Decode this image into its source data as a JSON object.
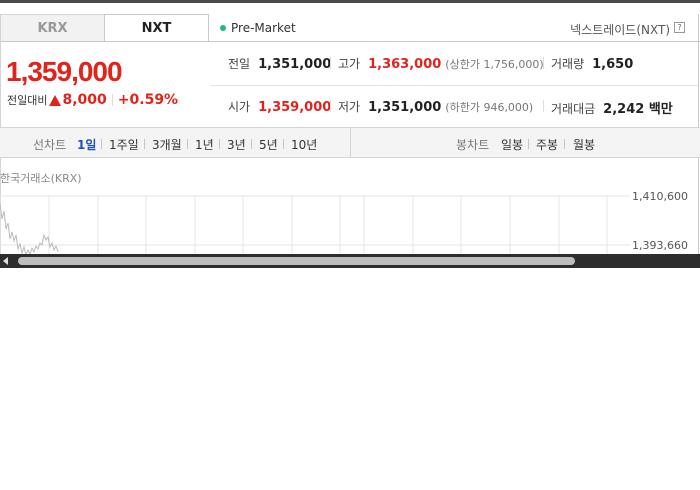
{
  "tabs": [
    "KRX",
    "NXT"
  ],
  "market_status": "Pre-Market",
  "exchange_name": "넥스트레이드(NXT)",
  "help_icon": "?",
  "price": "1,359,000",
  "change": {
    "label": "전일대비",
    "value": "8,000",
    "percent": "+0.59%",
    "direction": "up"
  },
  "info": {
    "prev_close": {
      "label": "전일",
      "value": "1,351,000"
    },
    "high": {
      "label": "고가",
      "value": "1,363,000",
      "sub": "(상한가 1,756,000)"
    },
    "volume": {
      "label": "거래량",
      "value": "1,650"
    },
    "open": {
      "label": "시가",
      "value": "1,359,000"
    },
    "low": {
      "label": "저가",
      "value": "1,351,000",
      "sub": "(하한가 946,000)"
    },
    "amount": {
      "label": "거래대금",
      "value": "2,242 백만"
    }
  },
  "line_chart": {
    "label": "선차트",
    "periods": [
      "1일",
      "1주일",
      "3개월",
      "1년",
      "3년",
      "5년",
      "10년"
    ],
    "selected": "1일"
  },
  "candle_chart": {
    "label": "봉차트",
    "periods": [
      "일봉",
      "주봉",
      "월봉"
    ]
  },
  "chart": {
    "exchange_label": "한국거래소(KRX)",
    "y_ticks": [
      "1,410,600",
      "1,393,660"
    ]
  },
  "colors": {
    "up": "#e0241c",
    "active_period": "#1f4fb8",
    "premarket_dot": "#1fb78a"
  }
}
